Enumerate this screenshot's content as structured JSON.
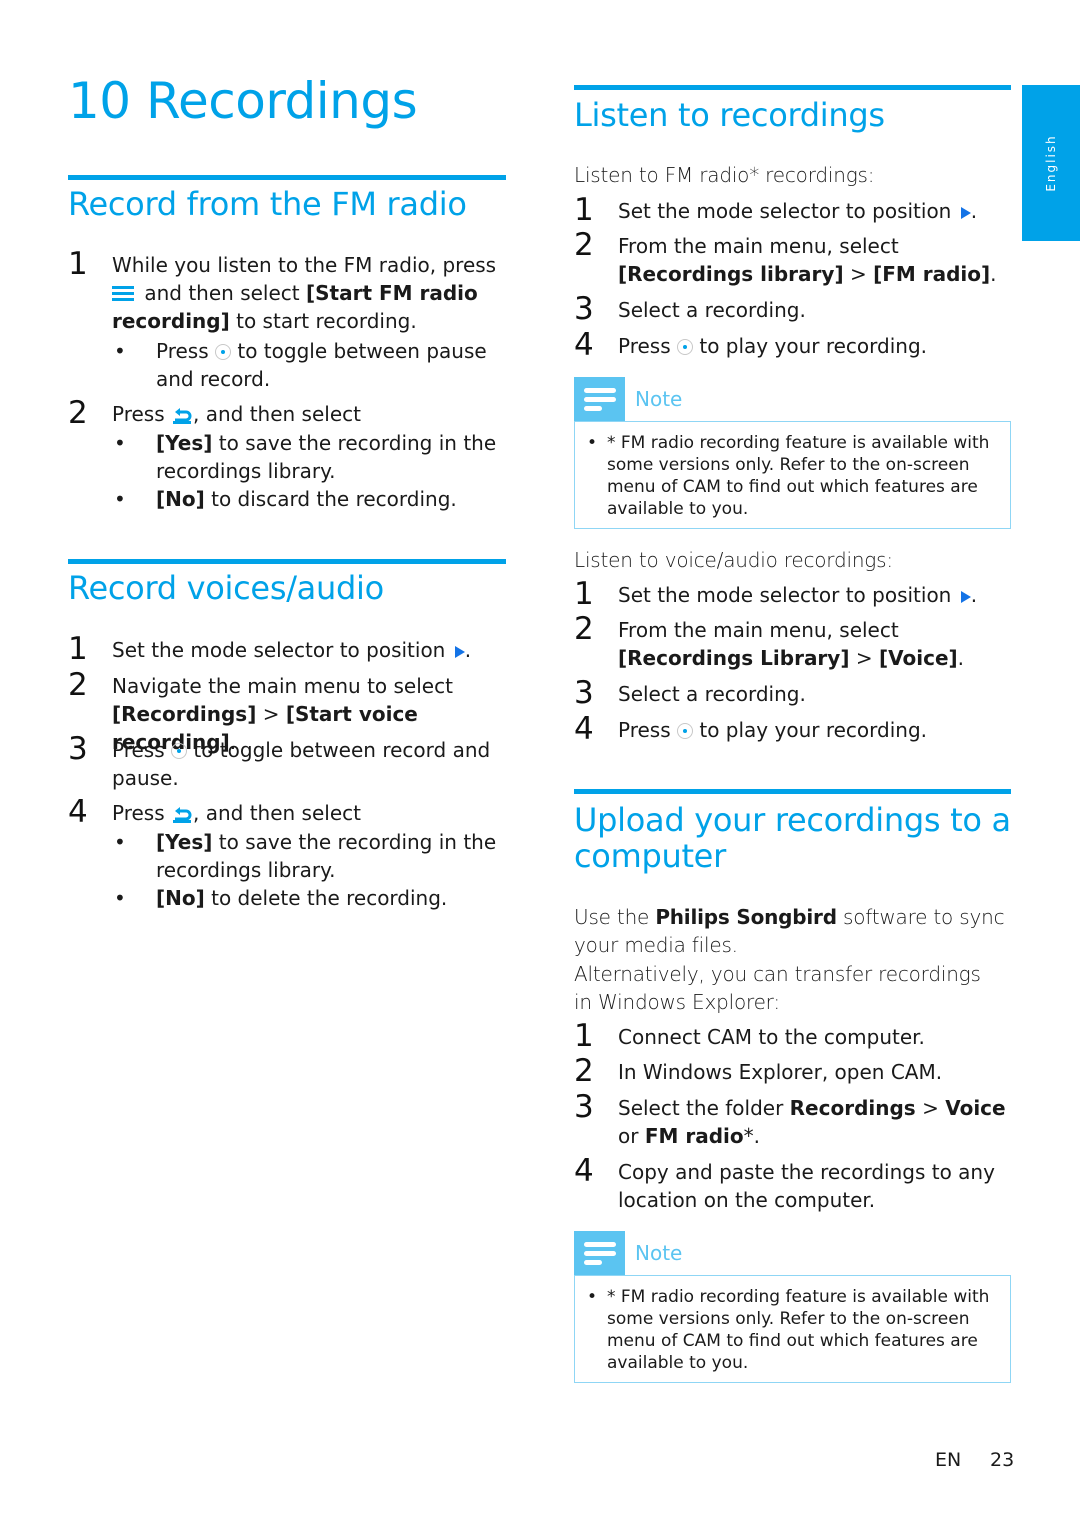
{
  "page_title": "10 Recordings",
  "language_tab": "English",
  "footer": {
    "lang": "EN",
    "page_number": "23"
  },
  "left": {
    "fm_section": {
      "title": "Record from the FM radio",
      "steps": [
        {
          "num": "1",
          "pre": "While you listen to the FM radio, press",
          "icon": "menu-icon",
          "mid": " and then select ",
          "bold": "[Start FM radio recording]",
          "post": " to start recording."
        },
        {
          "num": "2",
          "pre": "Press ",
          "icon": "back-icon",
          "post": ", and then select"
        }
      ],
      "step1_bullets": [
        {
          "pre": "Press ",
          "icon": "nav-button-icon",
          "post": " to toggle between pause and record."
        }
      ],
      "step2_bullets": [
        {
          "bold": "[Yes]",
          "post": " to save the recording in the recordings library."
        },
        {
          "bold": "[No]",
          "post": " to discard the recording."
        }
      ]
    },
    "voice_section": {
      "title": "Record voices/audio",
      "steps": [
        {
          "num": "1",
          "text": "Set the mode selector to position",
          "icon": "play-icon",
          "post": "."
        },
        {
          "num": "2",
          "text": "Navigate the main menu to select",
          "bold1": "[Recordings]",
          "sep": " > ",
          "bold2": "[Start voice recording]",
          "post": "."
        },
        {
          "num": "3",
          "pre": "Press ",
          "icon": "nav-button-icon",
          "post": " to toggle between record and pause."
        },
        {
          "num": "4",
          "pre": "Press ",
          "icon": "back-icon",
          "post": ", and then select"
        }
      ],
      "step4_bullets": [
        {
          "bold": "[Yes]",
          "post": " to save the recording in the recordings library."
        },
        {
          "bold": "[No]",
          "post": " to delete the recording."
        }
      ]
    }
  },
  "right": {
    "listen_section": {
      "title": "Listen to recordings",
      "fm_intro": "Listen to FM radio* recordings:",
      "fm_steps": [
        {
          "num": "1",
          "text": "Set the mode selector to position",
          "post": "."
        },
        {
          "num": "2",
          "text": "From the main menu, select ",
          "bold1": "[Recordings library]",
          "sep": " > ",
          "bold2": "[FM radio]",
          "post": "."
        },
        {
          "num": "3",
          "text": "Select a recording."
        },
        {
          "num": "4",
          "pre": "Press ",
          "post": " to play your recording."
        }
      ],
      "voice_intro": "Listen to voice/audio recordings:",
      "voice_steps": [
        {
          "num": "1",
          "text": "Set the mode selector to position",
          "post": "."
        },
        {
          "num": "2",
          "text": "From the main menu, select ",
          "bold1": "[Recordings Library]",
          "sep": " > ",
          "bold2": "[Voice]",
          "post": "."
        },
        {
          "num": "3",
          "text": "Select a recording."
        },
        {
          "num": "4",
          "pre": "Press ",
          "post": " to play your recording."
        }
      ]
    },
    "note1": {
      "label": "Note",
      "text": "* FM radio recording feature is available with some versions only. Refer to the on-screen menu of CAM to find out which features are available to you."
    },
    "upload_section": {
      "title": "Upload your recordings to a computer",
      "intro_pre": "Use the ",
      "intro_bold": "Philips Songbird",
      "intro_post": " software to sync your media files.",
      "intro2": "Alternatively, you can transfer recordings in Windows Explorer:",
      "steps": [
        {
          "num": "1",
          "text": "Connect CAM to the computer."
        },
        {
          "num": "2",
          "text": "In Windows Explorer, open CAM."
        },
        {
          "num": "3",
          "pre": "Select the folder ",
          "bold1": "Recordings",
          "sep": " > ",
          "bold2": "Voice",
          "mid": " or ",
          "bold3": "FM radio",
          "post": "*."
        },
        {
          "num": "4",
          "text": "Copy and paste the recordings to any location on the computer."
        }
      ]
    },
    "note2": {
      "label": "Note",
      "text": "* FM radio recording feature is available with some versions only. Refer to the on-screen menu of CAM to find out which features are available to you."
    }
  }
}
